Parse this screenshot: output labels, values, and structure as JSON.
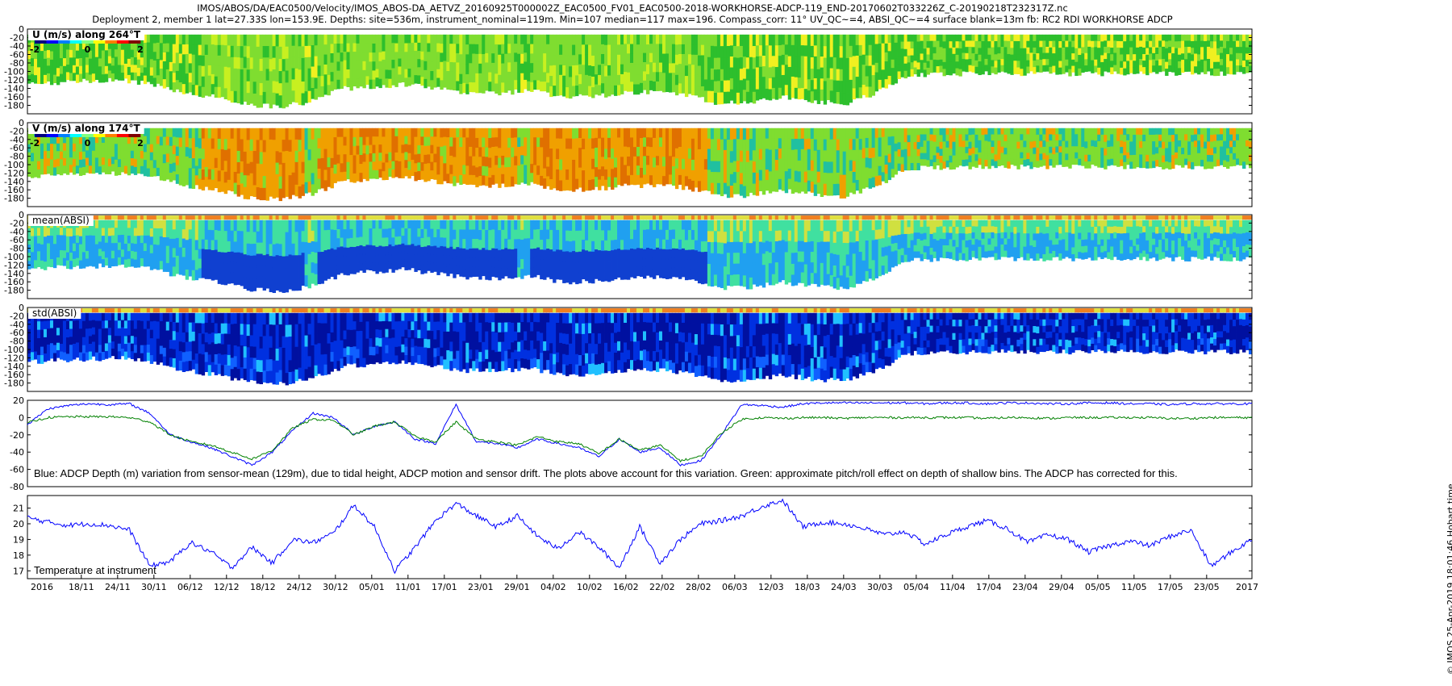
{
  "title": {
    "line1": "IMOS/ABOS/DA/EAC0500/Velocity/IMOS_ABOS-DA_AETVZ_20160925T000002Z_EAC0500_FV01_EAC0500-2018-WORKHORSE-ADCP-119_END-20170602T033226Z_C-20190218T232317Z.nc",
    "line2": "Deployment 2, member 1 lat=27.33S lon=153.9E. Depths: site=536m, instrument_nominal=119m. Min=107 median=117 max=196. Compass_corr: 11° UV_QC~=4, ABSI_QC~=4 surface blank=13m fb: RC2 RDI WORKHORSE ADCP"
  },
  "credit": "© IMOS 25-Apr-2019 18:01:46 Hobart time",
  "chart_data": [
    {
      "type": "heatmap",
      "title": "U (m/s) along 264°T",
      "colorbar": {
        "ticks": [
          "-2",
          "0",
          "2"
        ],
        "colors": [
          "#00007f",
          "#0000ff",
          "#007fff",
          "#00ffff",
          "#7fff7f",
          "#ffff00",
          "#ff7f00",
          "#ff0000",
          "#7f0000"
        ]
      },
      "y_ticks": [
        "0",
        "-20",
        "-40",
        "-60",
        "-80",
        "-100",
        "-120",
        "-140",
        "-160",
        "-180"
      ],
      "ylim": [
        -200,
        0
      ],
      "dominant_colors": [
        "#7fdd30",
        "#2dbf2d",
        "#c8f020",
        "#f0f020"
      ]
    },
    {
      "type": "heatmap",
      "title": "V (m/s) along 174°T",
      "colorbar": {
        "ticks": [
          "-2",
          "0",
          "2"
        ],
        "colors": [
          "#00007f",
          "#0000ff",
          "#007fff",
          "#00ffff",
          "#7fff7f",
          "#ffff00",
          "#ff7f00",
          "#ff0000",
          "#7f0000"
        ]
      },
      "y_ticks": [
        "0",
        "-20",
        "-40",
        "-60",
        "-80",
        "-100",
        "-120",
        "-140",
        "-160",
        "-180"
      ],
      "ylim": [
        -200,
        0
      ],
      "dominant_colors": [
        "#f0a000",
        "#e07000",
        "#7fdd30",
        "#20c0a0"
      ]
    },
    {
      "type": "heatmap",
      "title": "mean(ABSI)",
      "y_ticks": [
        "0",
        "-20",
        "-40",
        "-60",
        "-80",
        "-100",
        "-120",
        "-140",
        "-160",
        "-180"
      ],
      "ylim": [
        -200,
        0
      ],
      "dominant_colors": [
        "#1040d0",
        "#20a0f0",
        "#40e0a0",
        "#d0e040"
      ]
    },
    {
      "type": "heatmap",
      "title": "std(ABSI)",
      "y_ticks": [
        "0",
        "-20",
        "-40",
        "-60",
        "-80",
        "-100",
        "-120",
        "-140",
        "-160",
        "-180"
      ],
      "ylim": [
        -200,
        0
      ],
      "dominant_colors": [
        "#0010a0",
        "#0030e0",
        "#1060ff",
        "#20c0ff"
      ]
    },
    {
      "type": "line",
      "y_ticks": [
        "20",
        "0",
        "-20",
        "-40",
        "-60",
        "-80"
      ],
      "ylim": [
        -80,
        20
      ],
      "annotation": "Blue: ADCP Depth (m) variation from sensor-mean (129m), due to tidal height, ADCP motion and sensor drift. The plots above account for this variation. Green: approximate pitch/roll effect on depth of shallow bins. The ADCP has corrected for this.",
      "series": [
        {
          "color": "#0000ff",
          "values": [
            -8,
            10,
            14,
            16,
            15,
            16,
            5,
            -20,
            -28,
            -35,
            -45,
            -55,
            -40,
            -15,
            5,
            0,
            -20,
            -10,
            -5,
            -25,
            -30,
            15,
            -28,
            -30,
            -35,
            -25,
            -30,
            -35,
            -45,
            -25,
            -40,
            -35,
            -55,
            -50,
            -20,
            15,
            14,
            12,
            16,
            17,
            17,
            17,
            17,
            17,
            16,
            17,
            17,
            16,
            17,
            17,
            16,
            16,
            17,
            17,
            16,
            16,
            15,
            16,
            16,
            16,
            16
          ]
        },
        {
          "color": "#008000",
          "values": [
            -6,
            0,
            1,
            1,
            1,
            0,
            -5,
            -20,
            -28,
            -32,
            -40,
            -48,
            -38,
            -12,
            -2,
            -3,
            -20,
            -10,
            -5,
            -22,
            -28,
            -5,
            -25,
            -28,
            -32,
            -22,
            -28,
            -30,
            -42,
            -25,
            -38,
            -32,
            -50,
            -45,
            -18,
            -2,
            0,
            -1,
            0,
            0,
            -1,
            0,
            0,
            0,
            0,
            0,
            0,
            -1,
            0,
            0,
            -1,
            0,
            0,
            0,
            0,
            0,
            -1,
            -1,
            0,
            0,
            0
          ]
        }
      ]
    },
    {
      "type": "line",
      "annotation": "Temperature at instrument",
      "y_ticks": [
        "21",
        "20",
        "19",
        "18",
        "17"
      ],
      "ylim": [
        16.5,
        21.8
      ],
      "series": [
        {
          "color": "#0000ff",
          "values": [
            20.4,
            20.1,
            19.9,
            20.0,
            19.9,
            19.6,
            17.3,
            17.6,
            18.8,
            18.2,
            17.2,
            18.5,
            17.5,
            19.0,
            18.8,
            19.4,
            21.2,
            19.8,
            17.0,
            18.5,
            20.2,
            21.3,
            20.5,
            19.8,
            20.5,
            19.2,
            18.4,
            19.5,
            18.5,
            17.2,
            19.8,
            17.5,
            19.0,
            20.0,
            20.2,
            20.5,
            21.1,
            21.5,
            19.8,
            20.1,
            20.0,
            19.7,
            19.3,
            19.5,
            18.7,
            19.3,
            19.8,
            20.2,
            19.7,
            18.8,
            19.3,
            19.0,
            18.2,
            18.6,
            18.9,
            18.6,
            19.2,
            19.6,
            17.3,
            18.2,
            19.0
          ]
        }
      ]
    }
  ],
  "x_axis": {
    "year_start": "2016",
    "year_end": "2017",
    "ticks": [
      "18/11",
      "24/11",
      "30/11",
      "06/12",
      "12/12",
      "18/12",
      "24/12",
      "30/12",
      "05/01",
      "11/01",
      "17/01",
      "23/01",
      "29/01",
      "04/02",
      "10/02",
      "16/02",
      "22/02",
      "28/02",
      "06/03",
      "12/03",
      "18/03",
      "24/03",
      "30/03",
      "05/04",
      "11/04",
      "17/04",
      "23/04",
      "29/04",
      "05/05",
      "11/05",
      "17/05",
      "23/05"
    ]
  }
}
